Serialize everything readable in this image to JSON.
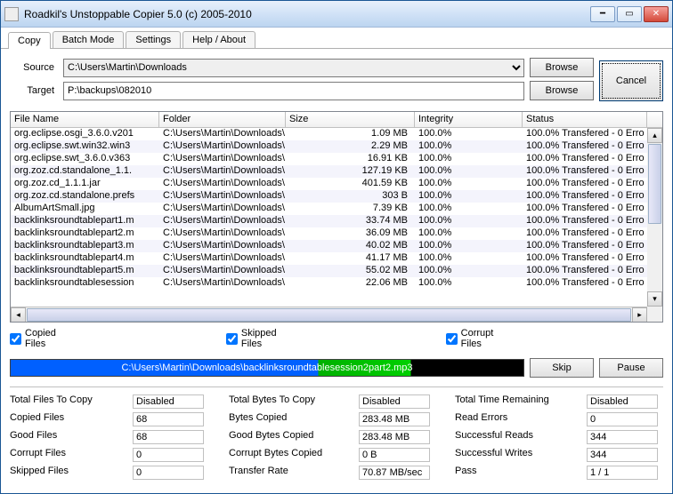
{
  "window": {
    "title": "Roadkil's Unstoppable Copier 5.0 (c) 2005-2010"
  },
  "tabs": [
    "Copy",
    "Batch Mode",
    "Settings",
    "Help / About"
  ],
  "active_tab": 0,
  "paths": {
    "source_label": "Source",
    "source_value": "C:\\Users\\Martin\\Downloads",
    "target_label": "Target",
    "target_value": "P:\\backups\\082010",
    "browse": "Browse",
    "cancel": "Cancel"
  },
  "columns": [
    "File Name",
    "Folder",
    "Size",
    "Integrity",
    "Status"
  ],
  "rows": [
    {
      "fn": "org.eclipse.osgi_3.6.0.v201",
      "fd": "C:\\Users\\Martin\\Downloads\\",
      "sz": "1.09 MB",
      "in": "100.0%",
      "st": "100.0% Transfered - 0 Erro"
    },
    {
      "fn": "org.eclipse.swt.win32.win3",
      "fd": "C:\\Users\\Martin\\Downloads\\",
      "sz": "2.29 MB",
      "in": "100.0%",
      "st": "100.0% Transfered - 0 Erro"
    },
    {
      "fn": "org.eclipse.swt_3.6.0.v363",
      "fd": "C:\\Users\\Martin\\Downloads\\",
      "sz": "16.91 KB",
      "in": "100.0%",
      "st": "100.0% Transfered - 0 Erro"
    },
    {
      "fn": "org.zoz.cd.standalone_1.1.",
      "fd": "C:\\Users\\Martin\\Downloads\\",
      "sz": "127.19 KB",
      "in": "100.0%",
      "st": "100.0% Transfered - 0 Erro"
    },
    {
      "fn": "org.zoz.cd_1.1.1.jar",
      "fd": "C:\\Users\\Martin\\Downloads\\",
      "sz": "401.59 KB",
      "in": "100.0%",
      "st": "100.0% Transfered - 0 Erro"
    },
    {
      "fn": "org.zoz.cd.standalone.prefs",
      "fd": "C:\\Users\\Martin\\Downloads\\",
      "sz": "303 B",
      "in": "100.0%",
      "st": "100.0% Transfered - 0 Erro"
    },
    {
      "fn": "AlbumArtSmall.jpg",
      "fd": "C:\\Users\\Martin\\Downloads\\",
      "sz": "7.39 KB",
      "in": "100.0%",
      "st": "100.0% Transfered - 0 Erro"
    },
    {
      "fn": "backlinksroundtablepart1.m",
      "fd": "C:\\Users\\Martin\\Downloads\\",
      "sz": "33.74 MB",
      "in": "100.0%",
      "st": "100.0% Transfered - 0 Erro"
    },
    {
      "fn": "backlinksroundtablepart2.m",
      "fd": "C:\\Users\\Martin\\Downloads\\",
      "sz": "36.09 MB",
      "in": "100.0%",
      "st": "100.0% Transfered - 0 Erro"
    },
    {
      "fn": "backlinksroundtablepart3.m",
      "fd": "C:\\Users\\Martin\\Downloads\\",
      "sz": "40.02 MB",
      "in": "100.0%",
      "st": "100.0% Transfered - 0 Erro"
    },
    {
      "fn": "backlinksroundtablepart4.m",
      "fd": "C:\\Users\\Martin\\Downloads\\",
      "sz": "41.17 MB",
      "in": "100.0%",
      "st": "100.0% Transfered - 0 Erro"
    },
    {
      "fn": "backlinksroundtablepart5.m",
      "fd": "C:\\Users\\Martin\\Downloads\\",
      "sz": "55.02 MB",
      "in": "100.0%",
      "st": "100.0% Transfered - 0 Erro"
    },
    {
      "fn": "backlinksroundtablesession",
      "fd": "C:\\Users\\Martin\\Downloads\\",
      "sz": "22.06 MB",
      "in": "100.0%",
      "st": "100.0% Transfered - 0 Erro"
    }
  ],
  "checks": {
    "copied": "Copied Files",
    "skipped": "Skipped Files",
    "corrupt": "Corrupt Files"
  },
  "progress": {
    "text": "C:\\Users\\Martin\\Downloads\\backlinksroundtablesession2part2.mp3",
    "skip": "Skip",
    "pause": "Pause"
  },
  "stats": {
    "labels": {
      "total_files": "Total Files To Copy",
      "copied_files": "Copied Files",
      "good_files": "Good Files",
      "corrupt_files": "Corrupt Files",
      "skipped_files": "Skipped Files",
      "total_bytes": "Total Bytes To Copy",
      "bytes_copied": "Bytes Copied",
      "good_bytes": "Good Bytes Copied",
      "corrupt_bytes": "Corrupt Bytes Copied",
      "rate": "Transfer Rate",
      "time_remain": "Total Time Remaining",
      "read_err": "Read Errors",
      "succ_reads": "Successful Reads",
      "succ_writes": "Successful Writes",
      "pass": "Pass"
    },
    "values": {
      "total_files": "Disabled",
      "copied_files": "68",
      "good_files": "68",
      "corrupt_files": "0",
      "skipped_files": "0",
      "total_bytes": "Disabled",
      "bytes_copied": "283.48 MB",
      "good_bytes": "283.48 MB",
      "corrupt_bytes": "0 B",
      "rate": "70.87 MB/sec",
      "time_remain": "Disabled",
      "read_err": "0",
      "succ_reads": "344",
      "succ_writes": "344",
      "pass": "1 / 1"
    }
  }
}
